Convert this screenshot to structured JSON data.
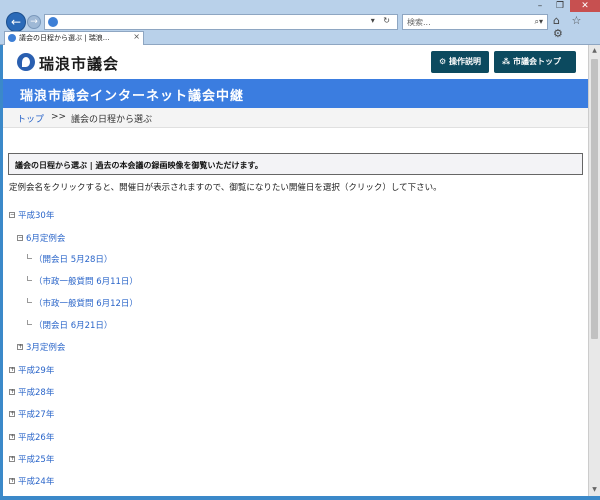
{
  "browser": {
    "address": "",
    "search_placeholder": "検索...",
    "tab_title": "議会の日程から選ぶ | 瑞浪...",
    "tab_close": "×",
    "window_controls": [
      "–",
      "❐",
      "✕"
    ],
    "tools": "⌂ ☆ ⚙"
  },
  "header": {
    "site_name": "瑞浪市議会",
    "help_button": "操作説明",
    "top_button": "市議会トップへ"
  },
  "title_band": "瑞浪市議会インターネット議会中継",
  "breadcrumb": {
    "home": "トップ",
    "separator": ">>",
    "current": "議会の日程から選ぶ"
  },
  "notice": "議会の日程から選ぶ | 過去の本会議の録画映像を御覧いただけます。",
  "intro": "定例会名をクリックすると、開催日が表示されますので、御覧になりたい開催日を選択（クリック）して下さい。",
  "tree": {
    "h30": {
      "label": "平成30年",
      "toggle": "−"
    },
    "june": {
      "label": "6月定例会",
      "toggle": "−"
    },
    "sessions": [
      "（開会日 5月28日）",
      "（市政一般質問 6月11日）",
      "（市政一般質問 6月12日）",
      "（閉会日 6月21日）"
    ],
    "march": {
      "label": "3月定例会",
      "toggle": "+"
    },
    "years": [
      "平成29年",
      "平成28年",
      "平成27年",
      "平成26年",
      "平成25年",
      "平成24年"
    ],
    "year_toggle": "+"
  }
}
